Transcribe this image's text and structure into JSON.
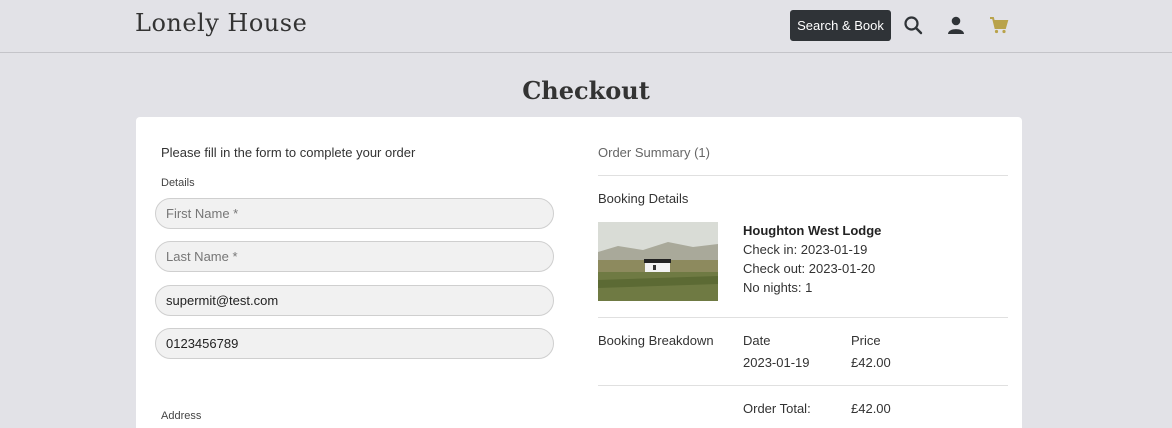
{
  "brand": "Lonely House",
  "nav": {
    "search_book_label": "Search & Book",
    "colors": {
      "cart": "#b9a34b",
      "dark": "#2f3337"
    }
  },
  "page_title": "Checkout",
  "form": {
    "intro": "Please fill in the form to complete your order",
    "details_label": "Details",
    "first_name_placeholder": "First Name *",
    "last_name_placeholder": "Last Name *",
    "email_value": "supermit@test.com",
    "phone_value": "0123456789",
    "address_label": "Address"
  },
  "summary": {
    "title": "Order Summary (1)",
    "booking_details_label": "Booking Details",
    "property_name": "Houghton West Lodge",
    "check_in": "Check in: 2023-01-19",
    "check_out": "Check out: 2023-01-20",
    "nights": "No nights: 1",
    "breakdown_label": "Booking Breakdown",
    "date_header": "Date",
    "price_header": "Price",
    "date_value": "2023-01-19",
    "price_value": "£42.00",
    "total_label": "Order Total:",
    "total_value": "£42.00"
  }
}
